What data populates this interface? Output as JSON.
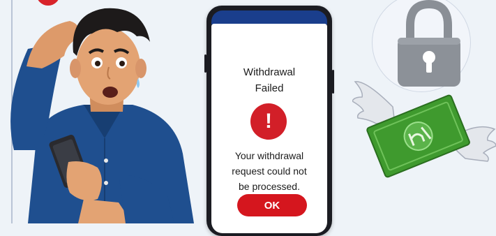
{
  "dialog": {
    "title": "Withdrawal\nFailed",
    "message": "Your withdrawal\nrequest could not\nbe processed.",
    "ok_label": "OK"
  },
  "colors": {
    "background": "#eef3f8",
    "phone_header": "#1a3e8c",
    "alert_red": "#d21f28",
    "button_red": "#d5161e",
    "shirt_blue": "#1f4f8f",
    "money_green": "#3f9a2e",
    "lock_gray": "#8c9198"
  },
  "icons": {
    "alert": "exclamation-icon",
    "lock": "padlock-icon",
    "money": "winged-banknote-icon"
  }
}
